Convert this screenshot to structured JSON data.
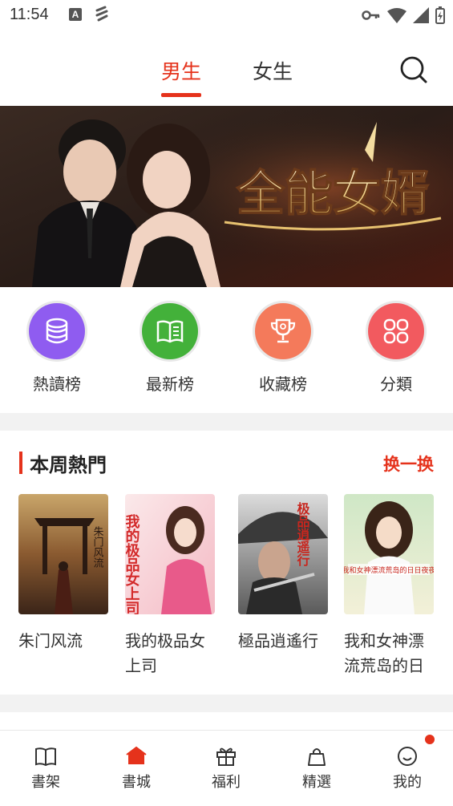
{
  "status_bar": {
    "time": "11:54",
    "notif_letter": "A"
  },
  "tabs": {
    "male": "男生",
    "female": "女生"
  },
  "banner": {
    "title": "全能女婿"
  },
  "categories": [
    {
      "label": "熱讀榜",
      "color": "#8f5cf0",
      "icon": "database-icon"
    },
    {
      "label": "最新榜",
      "color": "#43b13a",
      "icon": "open-book-icon"
    },
    {
      "label": "收藏榜",
      "color": "#f47a5b",
      "icon": "trophy-icon"
    },
    {
      "label": "分類",
      "color": "#f25a5f",
      "icon": "grid-icon"
    }
  ],
  "section": {
    "title": "本周熱門",
    "more": "换一换"
  },
  "books": [
    {
      "title": "朱门风流",
      "cover_text": "朱门风流"
    },
    {
      "title": "我的极品女上司",
      "cover_text": "我的极品女上司"
    },
    {
      "title": "極品逍遙行",
      "cover_text": "极品逍遥行"
    },
    {
      "title": "我和女神漂流荒岛的日",
      "cover_text": "我和女神漂流荒岛的日日夜夜"
    }
  ],
  "bottom_nav": [
    {
      "label": "書架",
      "icon": "bookshelf-icon",
      "active": false
    },
    {
      "label": "書城",
      "icon": "bookstore-icon",
      "active": true
    },
    {
      "label": "福利",
      "icon": "gift-icon",
      "active": false
    },
    {
      "label": "精選",
      "icon": "bag-icon",
      "active": false
    },
    {
      "label": "我的",
      "icon": "smile-icon",
      "active": false
    }
  ],
  "colors": {
    "accent": "#e5321b"
  }
}
